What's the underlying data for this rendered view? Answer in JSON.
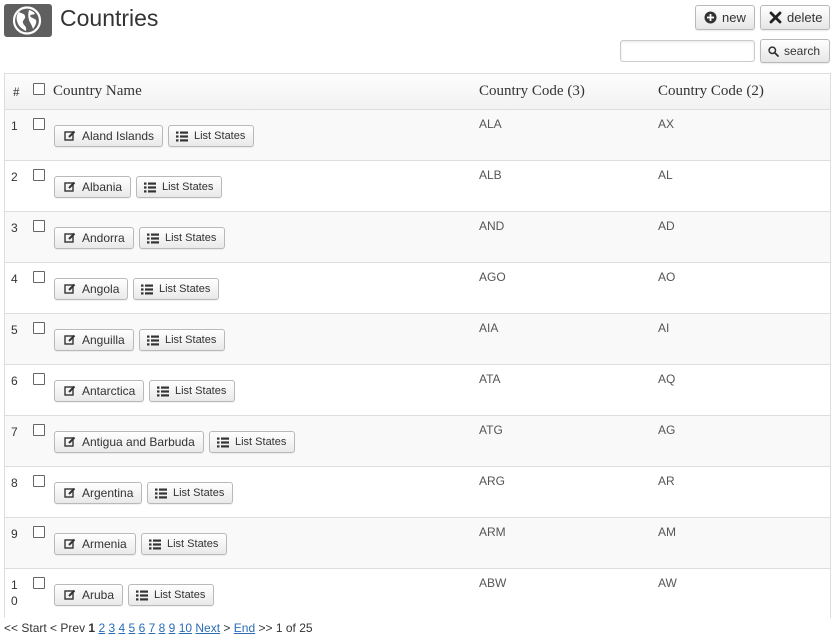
{
  "header": {
    "title": "Countries",
    "new_label": "new",
    "delete_label": "delete",
    "search_label": "search",
    "search_value": "",
    "search_placeholder": ""
  },
  "table": {
    "columns": [
      "#",
      "Country Name",
      "Country Code (3)",
      "Country Code (2)"
    ],
    "edit_icon": "edit-icon",
    "list_label": "List States",
    "rows": [
      {
        "num": "1",
        "name": "Aland Islands",
        "code3": "ALA",
        "code2": "AX"
      },
      {
        "num": "2",
        "name": "Albania",
        "code3": "ALB",
        "code2": "AL"
      },
      {
        "num": "3",
        "name": "Andorra",
        "code3": "AND",
        "code2": "AD"
      },
      {
        "num": "4",
        "name": "Angola",
        "code3": "AGO",
        "code2": "AO"
      },
      {
        "num": "5",
        "name": "Anguilla",
        "code3": "AIA",
        "code2": "AI"
      },
      {
        "num": "6",
        "name": "Antarctica",
        "code3": "ATA",
        "code2": "AQ"
      },
      {
        "num": "7",
        "name": "Antigua and Barbuda",
        "code3": "ATG",
        "code2": "AG"
      },
      {
        "num": "8",
        "name": "Argentina",
        "code3": "ARG",
        "code2": "AR"
      },
      {
        "num": "9",
        "name": "Armenia",
        "code3": "ARM",
        "code2": "AM"
      },
      {
        "num": "10",
        "name": "Aruba",
        "code3": "ABW",
        "code2": "AW"
      }
    ]
  },
  "pager": {
    "start": "<< Start",
    "prev": "< Prev",
    "current": "1",
    "pages": [
      "2",
      "3",
      "4",
      "5",
      "6",
      "7",
      "8",
      "9",
      "10"
    ],
    "next": "Next",
    "next_suffix": ">",
    "end": "End",
    "end_suffix": ">>",
    "summary": "1 of 25"
  },
  "colors": {
    "link": "#2a6db5",
    "logo_bg": "#5f5f5f"
  }
}
